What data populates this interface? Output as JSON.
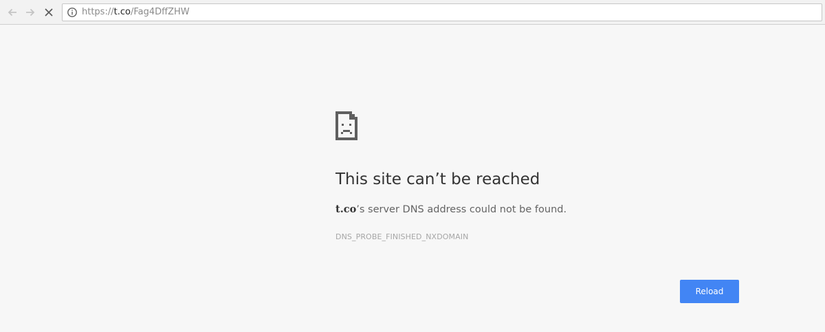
{
  "browser": {
    "url_scheme": "https://",
    "url_host": "t.co",
    "url_path": "/Fag4DffZHW",
    "icons": {
      "back": "back-arrow-icon",
      "forward": "forward-arrow-icon",
      "stop": "stop-loading-icon",
      "info": "info-icon"
    }
  },
  "error": {
    "icon": "sad-document-icon",
    "title": "This site can’t be reached",
    "host": "t.co",
    "message": "’s server DNS address could not be found.",
    "code": "DNS_PROBE_FINISHED_NXDOMAIN"
  },
  "actions": {
    "reload_label": "Reload"
  },
  "colors": {
    "background": "#f7f7f7",
    "button": "#4285f4"
  }
}
